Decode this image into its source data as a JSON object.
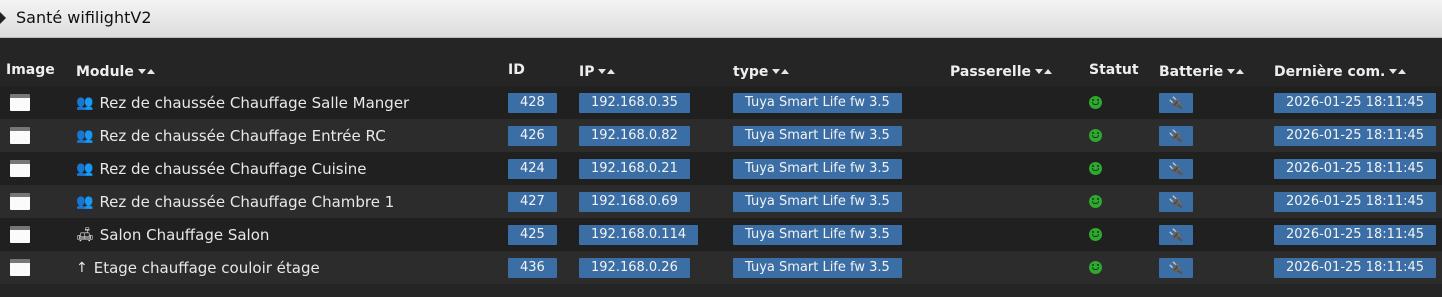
{
  "panel": {
    "title": "Santé wifilightV2"
  },
  "table": {
    "columns": {
      "image": "Image",
      "module": "Module",
      "id": "ID",
      "ip": "IP",
      "type": "type",
      "gateway": "Passerelle",
      "status": "Statut",
      "battery": "Batterie",
      "last_comm": "Dernière com."
    },
    "rows": [
      {
        "module_icon": "group-icon",
        "module": "Rez de chaussée Chauffage Salle Manger",
        "id": "428",
        "ip": "192.168.0.35",
        "type": "Tuya Smart Life fw 3.5",
        "gateway": "",
        "status_icon": "ok-smiley-icon",
        "battery_icon": "plug-icon",
        "last_comm": "2026-01-25 18:11:45"
      },
      {
        "module_icon": "group-icon",
        "module": "Rez de chaussée Chauffage Entrée RC",
        "id": "426",
        "ip": "192.168.0.82",
        "type": "Tuya Smart Life fw 3.5",
        "gateway": "",
        "status_icon": "ok-smiley-icon",
        "battery_icon": "plug-icon",
        "last_comm": "2026-01-25 18:11:45"
      },
      {
        "module_icon": "group-icon",
        "module": "Rez de chaussée Chauffage Cuisine",
        "id": "424",
        "ip": "192.168.0.21",
        "type": "Tuya Smart Life fw 3.5",
        "gateway": "",
        "status_icon": "ok-smiley-icon",
        "battery_icon": "plug-icon",
        "last_comm": "2026-01-25 18:11:45"
      },
      {
        "module_icon": "group-icon",
        "module": "Rez de chaussée Chauffage Chambre 1",
        "id": "427",
        "ip": "192.168.0.69",
        "type": "Tuya Smart Life fw 3.5",
        "gateway": "",
        "status_icon": "ok-smiley-icon",
        "battery_icon": "plug-icon",
        "last_comm": "2026-01-25 18:11:45"
      },
      {
        "module_icon": "sofa-icon",
        "module": "Salon Chauffage Salon",
        "id": "425",
        "ip": "192.168.0.114",
        "type": "Tuya Smart Life fw 3.5",
        "gateway": "",
        "status_icon": "ok-smiley-icon",
        "battery_icon": "plug-icon",
        "last_comm": "2026-01-25 18:11:45"
      },
      {
        "module_icon": "arrow-up-icon",
        "module": "Etage chauffage couloir étage",
        "id": "436",
        "ip": "192.168.0.26",
        "type": "Tuya Smart Life fw 3.5",
        "gateway": "",
        "status_icon": "ok-smiley-icon",
        "battery_icon": "plug-icon",
        "last_comm": "2026-01-25 18:11:45"
      }
    ]
  },
  "colors": {
    "tag_background": "#3b6ea5",
    "status_ok": "#2fa82f",
    "row_odd": "#202020",
    "row_even": "#2c2c2c"
  }
}
